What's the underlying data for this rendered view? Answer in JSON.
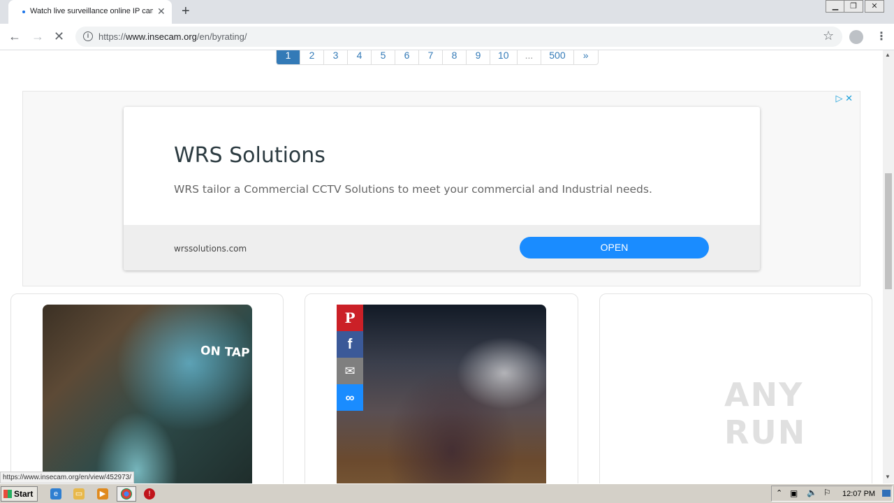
{
  "browser": {
    "tab_title": "Watch live surveillance online IP cam",
    "url_prefix": "https://",
    "url_host": "www.insecam.org",
    "url_path": "/en/byrating/",
    "status_url": "https://www.insecam.org/en/view/452973/"
  },
  "pagination": {
    "pages": [
      "1",
      "2",
      "3",
      "4",
      "5",
      "6",
      "7",
      "8",
      "9",
      "10",
      "...",
      "500",
      "»"
    ],
    "active": "1"
  },
  "ad": {
    "headline": "WRS Solutions",
    "description": "WRS tailor a Commercial CCTV Solutions to meet your commercial and Industrial needs.",
    "domain": "wrssolutions.com",
    "cta": "OPEN"
  },
  "cameras": [
    {
      "overlay_text": "ON TAP"
    },
    {
      "overlay_text": ""
    }
  ],
  "watermark": "ANY RUN",
  "taskbar": {
    "start_label": "Start",
    "clock": "12:07 PM"
  },
  "colors": {
    "pager_active": "#337ab7",
    "ad_button": "#1a8cff",
    "pinterest": "#cb2027",
    "facebook": "#3b5998",
    "email": "#7f7f7f",
    "link": "#1a8cff"
  }
}
